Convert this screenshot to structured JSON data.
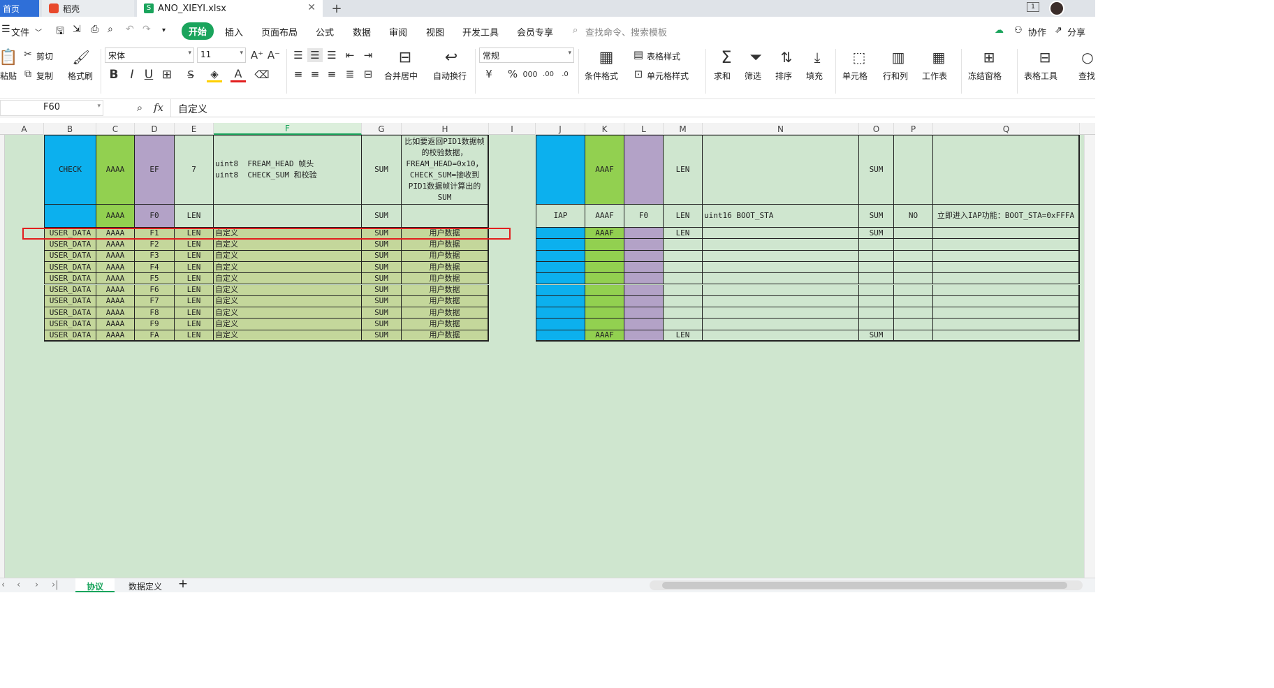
{
  "tabs": {
    "home": "首页",
    "docer": "稻壳",
    "file": "ANO_XIEYI.xlsx",
    "new_tab": "+"
  },
  "menu": {
    "file": "文件",
    "items": [
      "开始",
      "插入",
      "页面布局",
      "公式",
      "数据",
      "审阅",
      "视图",
      "开发工具",
      "会员专享"
    ],
    "search_placeholder": "查找命令、搜索模板",
    "collab": "协作",
    "share": "分享"
  },
  "ribbon": {
    "paste": "粘贴",
    "cut": "剪切",
    "copy": "复制",
    "format_painter": "格式刷",
    "font": "宋体",
    "size": "11",
    "merge": "合并居中",
    "wrap": "自动换行",
    "number_format": "常规",
    "cond_format": "条件格式",
    "table_style": "表格样式",
    "cell_style": "单元格样式",
    "sum": "求和",
    "filter": "筛选",
    "sort": "排序",
    "fill": "填充",
    "cells": "单元格",
    "rowcol": "行和列",
    "sheet": "工作表",
    "freeze": "冻结窗格",
    "tools": "表格工具",
    "find": "查找"
  },
  "formula_bar": {
    "cell_ref": "F60",
    "content": "自定义"
  },
  "columns": [
    "A",
    "B",
    "C",
    "D",
    "E",
    "F",
    "G",
    "H",
    "I",
    "J",
    "K",
    "L",
    "M",
    "N",
    "O",
    "P",
    "Q"
  ],
  "table_left": {
    "row_check": [
      "CHECK",
      "AAAA",
      "EF",
      "7",
      "uint8  FREAM_HEAD 帧头\nuint8  CHECK_SUM 和校验",
      "SUM",
      "比如要返回PID1数据帧的校验数据，FREAM_HEAD=0x10，CHECK_SUM=接收到PID1数据帧计算出的SUM"
    ],
    "row_f0": [
      "",
      "AAAA",
      "F0",
      "LEN",
      "",
      "SUM",
      ""
    ],
    "user_rows": [
      [
        "USER_DATA",
        "AAAA",
        "F1",
        "LEN",
        "自定义",
        "SUM",
        "用户数据"
      ],
      [
        "USER_DATA",
        "AAAA",
        "F2",
        "LEN",
        "自定义",
        "SUM",
        "用户数据"
      ],
      [
        "USER_DATA",
        "AAAA",
        "F3",
        "LEN",
        "自定义",
        "SUM",
        "用户数据"
      ],
      [
        "USER_DATA",
        "AAAA",
        "F4",
        "LEN",
        "自定义",
        "SUM",
        "用户数据"
      ],
      [
        "USER_DATA",
        "AAAA",
        "F5",
        "LEN",
        "自定义",
        "SUM",
        "用户数据"
      ],
      [
        "USER_DATA",
        "AAAA",
        "F6",
        "LEN",
        "自定义",
        "SUM",
        "用户数据"
      ],
      [
        "USER_DATA",
        "AAAA",
        "F7",
        "LEN",
        "自定义",
        "SUM",
        "用户数据"
      ],
      [
        "USER_DATA",
        "AAAA",
        "F8",
        "LEN",
        "自定义",
        "SUM",
        "用户数据"
      ],
      [
        "USER_DATA",
        "AAAA",
        "F9",
        "LEN",
        "自定义",
        "SUM",
        "用户数据"
      ],
      [
        "USER_DATA",
        "AAAA",
        "FA",
        "LEN",
        "自定义",
        "SUM",
        "用户数据"
      ]
    ]
  },
  "table_right": {
    "row_check": [
      "",
      "AAAF",
      "",
      "LEN",
      "",
      "SUM",
      "",
      ""
    ],
    "row_iap": [
      "IAP",
      "AAAF",
      "F0",
      "LEN",
      "uint16 BOOT_STA",
      "SUM",
      "NO",
      "立即进入IAP功能：BOOT_STA=0xFFFA"
    ],
    "user_rows": [
      [
        "",
        "AAAF",
        "",
        "LEN",
        "",
        "SUM",
        "",
        ""
      ],
      [
        "",
        "",
        "",
        "",
        "",
        "",
        "",
        ""
      ],
      [
        "",
        "",
        "",
        "",
        "",
        "",
        "",
        ""
      ],
      [
        "",
        "",
        "",
        "",
        "",
        "",
        "",
        ""
      ],
      [
        "",
        "",
        "",
        "",
        "",
        "",
        "",
        ""
      ],
      [
        "",
        "",
        "",
        "",
        "",
        "",
        "",
        ""
      ],
      [
        "",
        "",
        "",
        "",
        "",
        "",
        "",
        ""
      ],
      [
        "",
        "",
        "",
        "",
        "",
        "",
        "",
        ""
      ],
      [
        "",
        "",
        "",
        "",
        "",
        "",
        "",
        ""
      ],
      [
        "",
        "AAAF",
        "",
        "LEN",
        "",
        "SUM",
        "",
        ""
      ]
    ]
  },
  "sheets": {
    "active": "协议",
    "other": "数据定义",
    "add": "+"
  },
  "colors": {
    "blue": "#0cb0ee",
    "green": "#92d050",
    "purple": "#b3a2c7",
    "olive": "#c4d79b",
    "mint": "#cfe6cf",
    "accent": "#1aa45c",
    "highlight": "#e21f1f"
  }
}
